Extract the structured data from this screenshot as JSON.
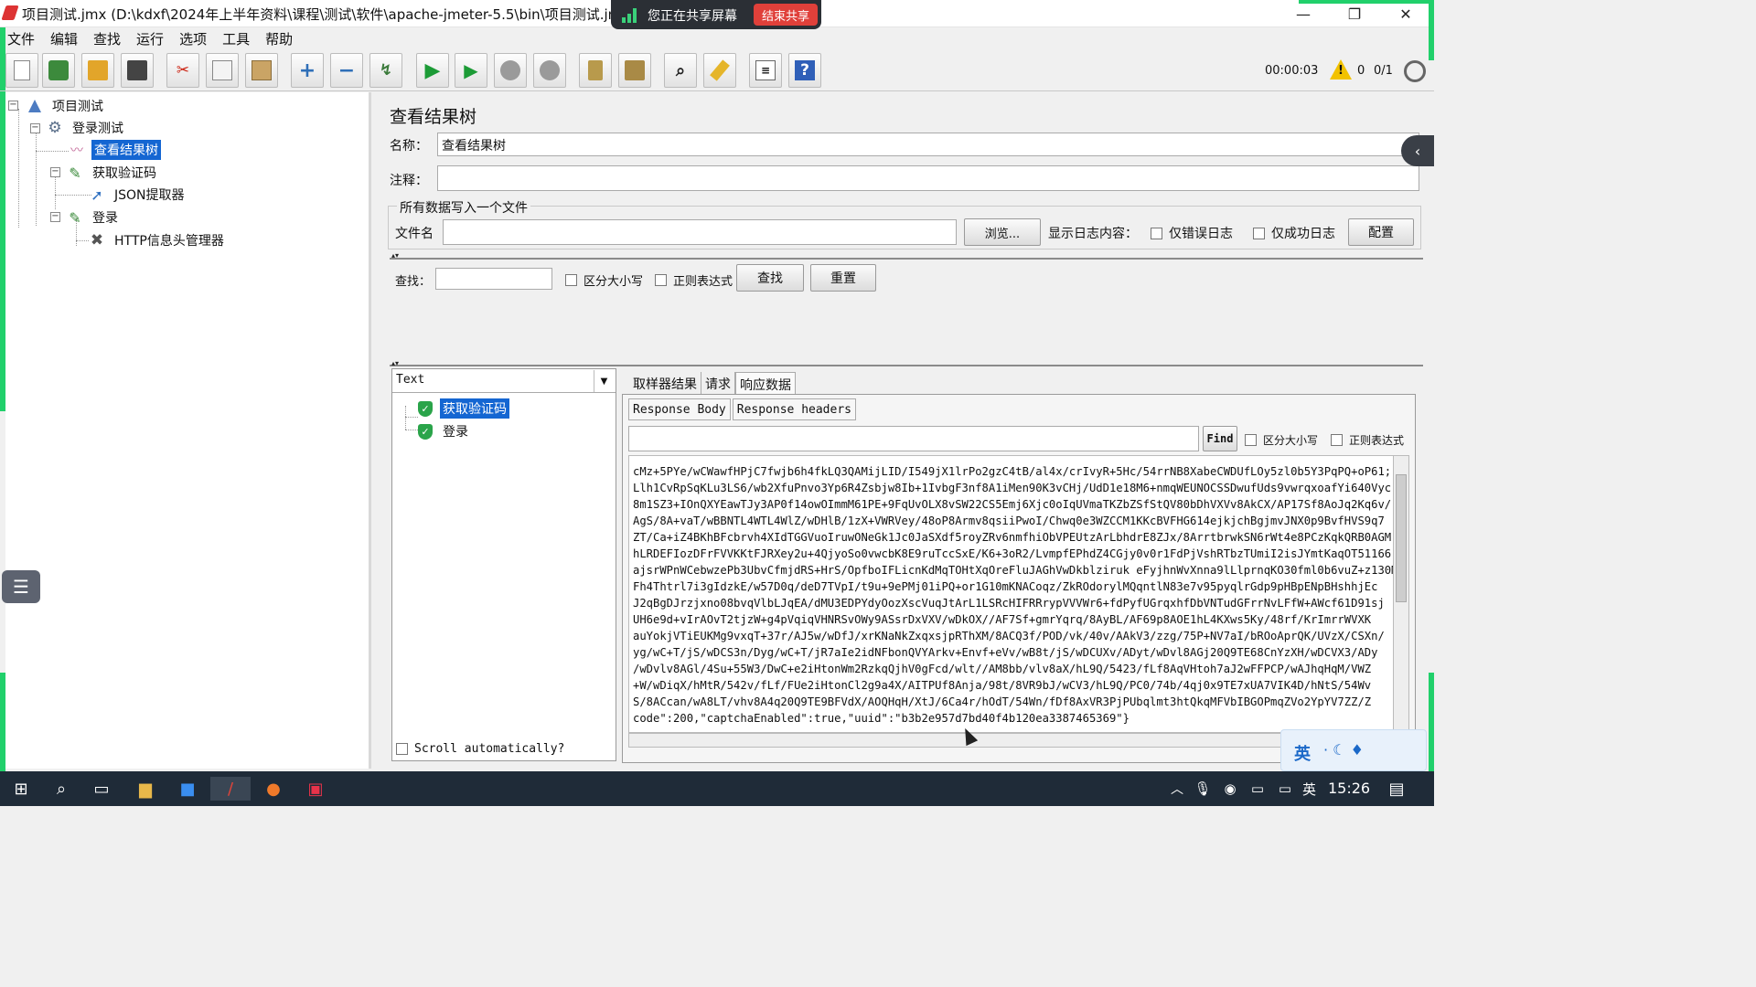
{
  "window": {
    "title": "项目测试.jmx (D:\\kdxf\\2024年上半年资料\\课程\\测试\\软件\\apache-jmeter-5.5\\bin\\项目测试.jmx)",
    "minimize": "—",
    "maximize": "❐",
    "close": "✕"
  },
  "share_bar": {
    "text": "您正在共享屏幕",
    "end_label": "结束共享"
  },
  "menu": [
    "文件",
    "编辑",
    "查找",
    "运行",
    "选项",
    "工具",
    "帮助"
  ],
  "toolbar": {
    "icons": [
      "new-icon",
      "templates-icon",
      "open-icon",
      "save-icon",
      "cut-icon",
      "copy-icon",
      "paste-icon",
      "expand-icon",
      "collapse-icon",
      "toggle-icon",
      "start-icon",
      "start-no-pause-icon",
      "stop-icon",
      "shutdown-icon",
      "clear-icon",
      "clear-all-icon",
      "search-icon",
      "reset-search-icon",
      "function-helper-icon",
      "help-icon"
    ],
    "timer": "00:00:03",
    "warnings": "0",
    "threads": "0/1"
  },
  "tree": {
    "items": [
      {
        "label": "项目测试",
        "icon": "flask-icon"
      },
      {
        "label": "登录测试",
        "icon": "gear-icon"
      },
      {
        "label": "查看结果树",
        "icon": "chart-icon",
        "selected": true
      },
      {
        "label": "获取验证码",
        "icon": "pipette-icon"
      },
      {
        "label": "JSON提取器",
        "icon": "extractor-icon"
      },
      {
        "label": "登录",
        "icon": "pipette-icon"
      },
      {
        "label": "HTTP信息头管理器",
        "icon": "tools-icon"
      }
    ]
  },
  "panel": {
    "title": "查看结果树",
    "name_label": "名称：",
    "name_value": "查看结果树",
    "comment_label": "注释：",
    "comment_value": "",
    "file_group_label": "所有数据写入一个文件",
    "filename_label": "文件名",
    "filename_value": "",
    "browse_label": "浏览...",
    "log_label": "显示日志内容：",
    "errors_only": "仅错误日志",
    "success_only": "仅成功日志",
    "configure": "配置",
    "search_label": "查找：",
    "search_value": "",
    "case_sensitive": "区分大小写",
    "regex": "正则表达式",
    "find_button": "查找",
    "reset_button": "重置"
  },
  "results": {
    "renderer": "Text",
    "samples": [
      "获取验证码",
      "登录"
    ],
    "scroll_auto": "Scroll automatically?",
    "tabs": [
      "取样器结果",
      "请求",
      "响应数据"
    ],
    "active_tab": "响应数据",
    "subtabs": [
      "Response Body",
      "Response headers"
    ],
    "find_label": "Find",
    "case_sensitive": "区分大小写",
    "regex": "正则表达式",
    "body_lines": [
      "cMz+5PYe/wCWawfHPjC7fwjb6h4fkLQ3QAMijLID/I549jX1lrPo2gzC4tB/al4x/crIvyR+5Hc/54rrNB8XabeCWDUfLOy5zl0b5Y3PqPQ+oP61;",
      "Llh1CvRpSqKLu3LS6/wb2XfuPnvo3Yp6R4Zsbjw8Ib+1IvbgF3nf8A1iMen90K3vCHj/UdD1e18M6+nmqWEUNOCSSDwufUds9vwrqxoafYi640Vyc",
      "8m1SZ3+IOnQXYEawTJy3AP0f14owOImmM61PE+9FqUvOLX8vSW22CS5Emj6Xjc0oIqUVmaTKZbZSfStQV80bDhVXVv8AkCX/AP17Sf8AoJq2Kq6v/",
      "AgS/8A+vaT/wBBNTL4WTL4WlZ/wDHlB/1zX+VWRVey/48oP8Armv8qsiiPwoI/Chwq0e3WZCCM1KKcBVFHG614ejkjchBgjmvJNX0p9BvfHVS9q7",
      "ZT/Ca+iZ4BKhBFcbrvh4XIdTGGVuoIruwONeGk1Jc0JaSXdf5royZRv6nmfhiObVPEUtzArLbhdrE8ZJx/8ArrtbrwkSN6rWt4e8PCzKqkQRB0AGM",
      "hLRDEFIozDFrFVVKKtFJRXey2u+4QjyoSo0vwcbK8E9ruTccSxE/K6+3oR2/LvmpfEPhdZ4CGjy0v0r1FdPjVshRTbzTUmiI2isJYmtKaqOT51166",
      "ajsrWPnWCebwzePb3UbvCfmjdRS+HrS/OpfboIFLicnKdMqTOHtXqOreFluJAGhVwDkblziruk eFyjhnWvXnna9lLlprnqKO30fml0b6vuZ+z130M",
      "Fh4Thtrl7i3gIdzkE/w57D0q/deD7TVpI/t9u+9ePMj01iPQ+or1G10mKNACoqz/ZkROdorylMQqntlN83e7v95pyqlrGdp9pHBpENpBHshhjEc",
      "J2qBgDJrzjxno08bvqVlbLJqEA/dMU3EDPYdyOozXscVuqJtArL1LSRcHIFRRrypVVVWr6+fdPyfUGrqxhfDbVNTudGFrrNvLFfW+AWcf61D91sj",
      "UH6e9d+vIrAOvT2tjzW+g4pVqiqVHNRSvOWy9ASsrDxVXV/wDkOX//AF7Sf+gmrYqrq/8AyBL/AF69p8AOE1hL4KXws5Ky/48rf/KrImrrWVXK",
      "auYokjVTiEUKMg9vxqT+37r/AJ5w/wDfJ/xrKNaNkZxqxsjpRThXM/8ACQ3f/POD/vk/40v/AAkV3/zzg/75P+NV7aI/bROoAprQK/UVzX/CSXn/",
      "yg/wC+T/jS/wDCS3n/Dyg/wC+T/jR7aIe2idNFbonQVYArkv+Envf+eVv/wB8t/jS/wDCUXv/ADyt/wDvl8AGj20Q9TE68CnYzXH/wDCVX3/ADy",
      "/wDvlv8AGl/4Su+55W3/DwC+e2iHtonWm2RzkqQjhV0gFcd/wlt//AM8bb/vlv8aX/hL9Q/5423/fLf8AqVHtoh7aJ2wFFPCP/wAJhqHqM/VWZ",
      "+W/wDiqX/hMtR/542v/fLf/FUe2iHtonCl2g9a4X/AITPUf8Anja/98t/8VR9bJ/wCV3/hL9Q/PC0/74b/4qj0x9TE7xUA7VIK4D/hNtS/54Wv",
      "S/8ACcan/wA8LT/vhv8A4q20Q9TE9BFVdX/AOQHqH/XtJ/6Ca4r/hOdT/54Wn/fDf8AxVR3PjPUbqlmt3htQkqMFVbIBGOPmqZVo2YpYV7ZZ/Z",
      "code\":200,\"captchaEnabled\":true,\"uuid\":\"b3b2e957d7bd40f4b120ea3387465369\"}"
    ]
  },
  "ime": {
    "label": "英"
  },
  "taskbar": {
    "time": "15:26",
    "lang": "英"
  }
}
